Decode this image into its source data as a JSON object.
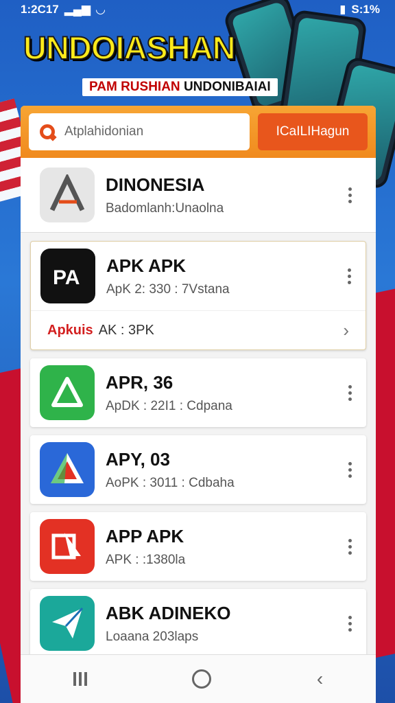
{
  "status_bar": {
    "time": "1:2C17",
    "right": "S:1%"
  },
  "banner": {
    "title": "UNDOIASHAN",
    "subtitle_part1": "PAM RUSHIAN",
    "subtitle_part2": "UNDONIBAIAI"
  },
  "search": {
    "placeholder": "Atplahidonian",
    "button_label": "ICaILIHagun"
  },
  "apps": [
    {
      "name": "DINONESIA",
      "meta": "Badomlanh:Unaolna",
      "icon": "abstract-a-icon",
      "color": "#6b6b6b"
    },
    {
      "name": "APK APK",
      "meta": "ApK 2: 330 : 7Vstana",
      "icon": "pa-icon",
      "color": "#111111",
      "expanded": {
        "brand": "Apkuis",
        "text": "AK : 3PK"
      }
    },
    {
      "name": "APR, 36",
      "meta": "ApDK : 22I1 : Cdpana",
      "icon": "triangle-icon",
      "color": "#2fb34a"
    },
    {
      "name": "APY, 03",
      "meta": "AoPK : 3011 : Cdbaha",
      "icon": "a-logo-icon",
      "color": "#2a68d8"
    },
    {
      "name": "APP APK",
      "meta": "APK : :1380la",
      "icon": "red-box-icon",
      "color": "#e33124"
    },
    {
      "name": "ABK ADINEKO",
      "meta": "Loaana 203laps",
      "icon": "paper-plane-icon",
      "color": "#1ba89a"
    }
  ]
}
